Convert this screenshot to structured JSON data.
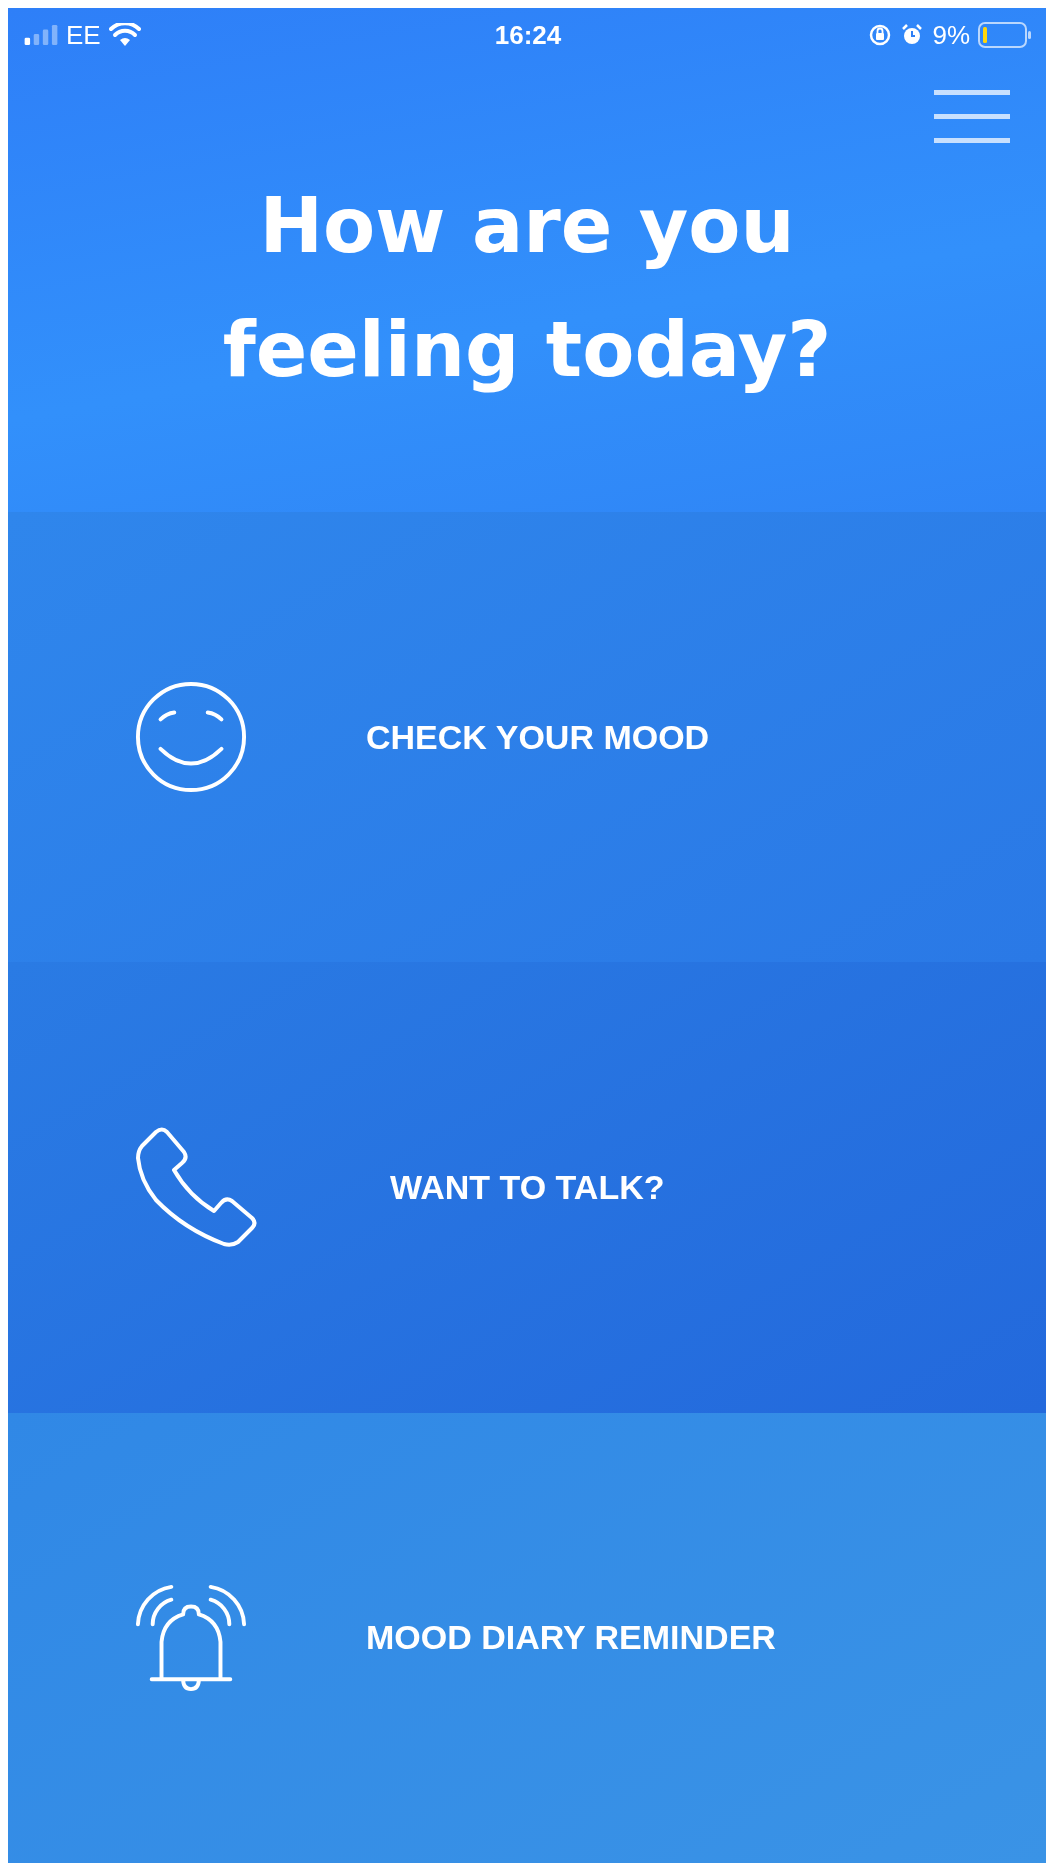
{
  "status_bar": {
    "carrier": "EE",
    "time": "16:24",
    "battery": "9%"
  },
  "header": {
    "title_lines": [
      "How are you",
      "feeling today?"
    ]
  },
  "menu_items": [
    {
      "kind": "mood",
      "label": "CHECK YOUR MOOD"
    },
    {
      "kind": "talk",
      "label": "WANT TO TALK?"
    },
    {
      "kind": "reminder",
      "label": "MOOD DIARY REMINDER"
    }
  ]
}
